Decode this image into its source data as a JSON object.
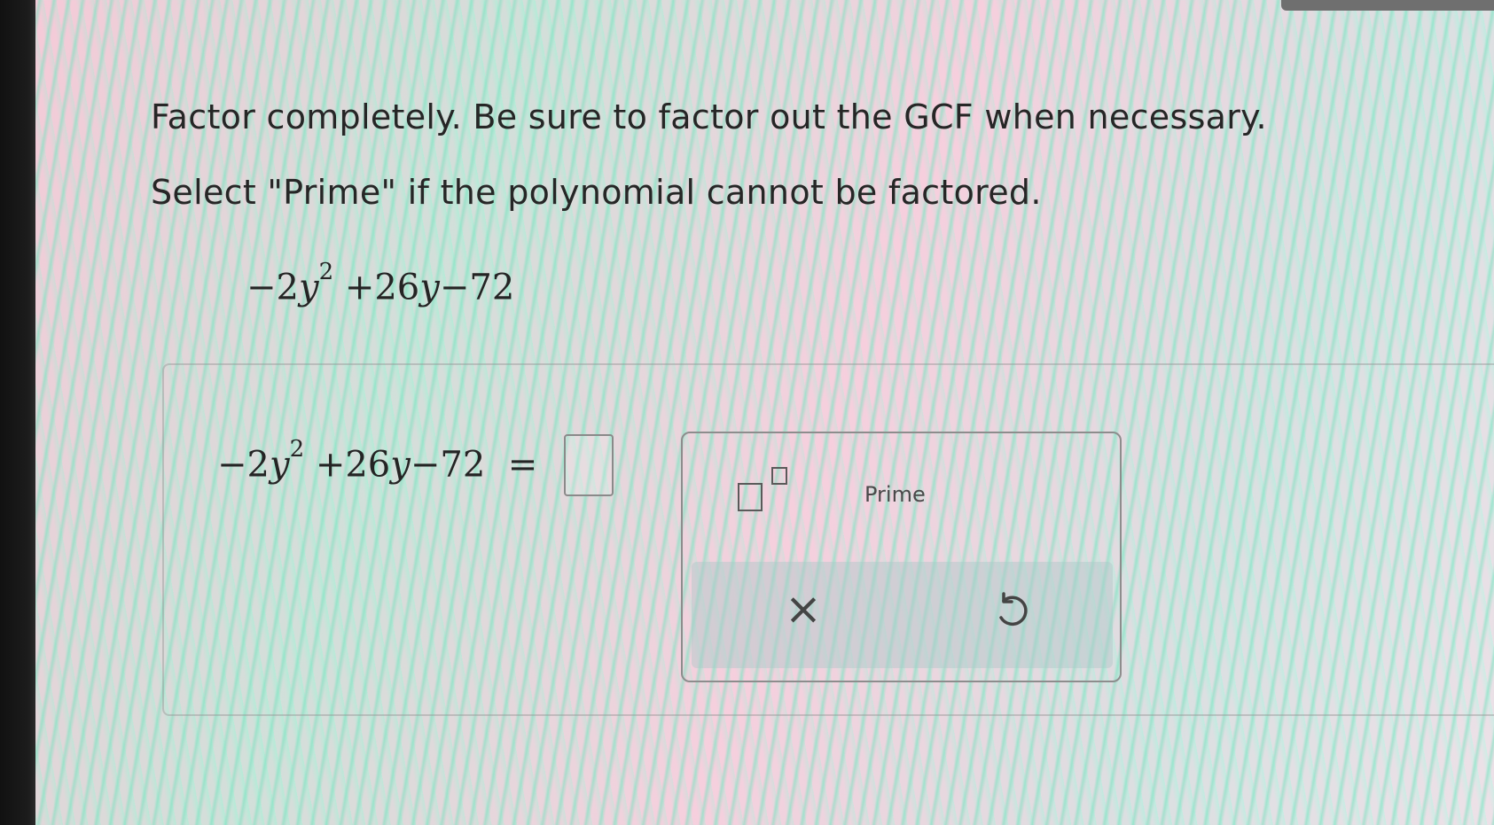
{
  "question": {
    "line1": "Factor completely. Be sure to factor out the GCF when necessary.",
    "line2": "Select \"Prime\" if the polynomial cannot be factored."
  },
  "polynomial": {
    "term1_coef": "−2",
    "term1_var": "y",
    "term1_exp": "2",
    "term2": "+26",
    "term2_var": "y",
    "term3": "−72"
  },
  "equation": {
    "lhs_coef": "−2",
    "lhs_var": "y",
    "lhs_exp": "2",
    "lhs_term2": "+26",
    "lhs_term2_var": "y",
    "lhs_term3": "−72",
    "equals": "=",
    "answer_value": ""
  },
  "keypad": {
    "exponent_icon": "exponent-template-icon",
    "prime_label": "Prime",
    "clear_icon": "close-icon",
    "clear_symbol": "×",
    "undo_icon": "undo-icon"
  },
  "colors": {
    "text": "#262626",
    "keypad_border": "#8d8d8d",
    "action_bar": "#aac8c8"
  }
}
